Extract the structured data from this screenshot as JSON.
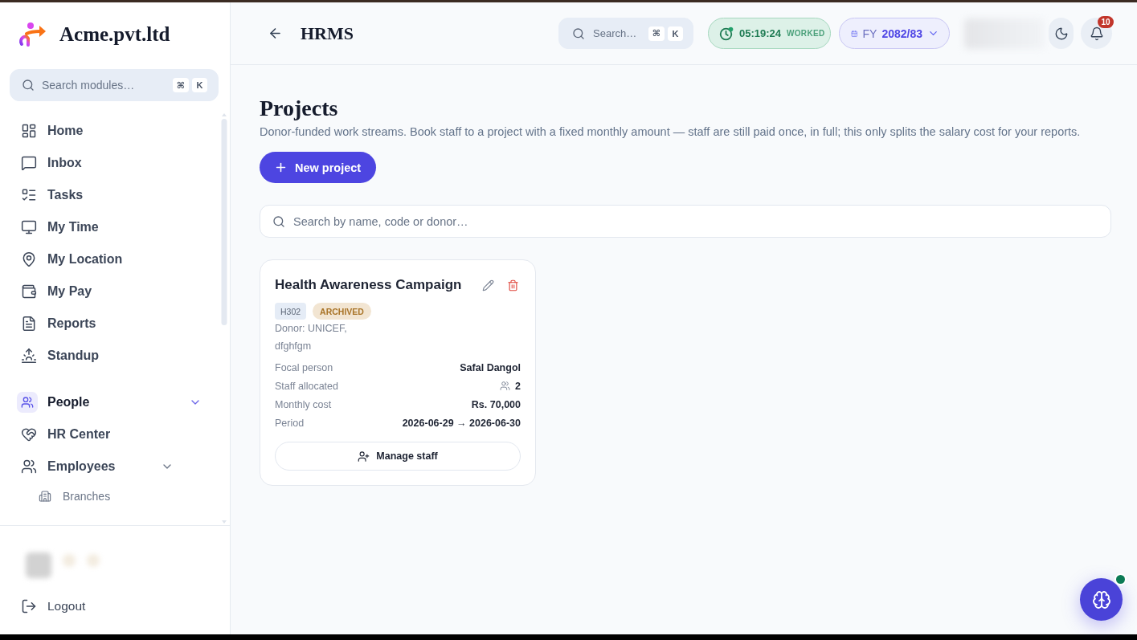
{
  "sidebar": {
    "brand": "Acme.pvt.ltd",
    "search": {
      "placeholder": "Search modules…",
      "shortcut": [
        "⌘",
        "K"
      ]
    },
    "items": [
      {
        "label": "Home"
      },
      {
        "label": "Inbox"
      },
      {
        "label": "Tasks"
      },
      {
        "label": "My Time"
      },
      {
        "label": "My Location"
      },
      {
        "label": "My Pay"
      },
      {
        "label": "Reports"
      },
      {
        "label": "Standup"
      }
    ],
    "sections": [
      {
        "label": "People",
        "expanded": true,
        "items": [
          {
            "label": "HR Center"
          },
          {
            "label": "Employees",
            "expanded": true,
            "children": [
              {
                "label": "Branches"
              }
            ]
          }
        ]
      }
    ],
    "footer": {
      "logout": "Logout"
    }
  },
  "header": {
    "title": "HRMS",
    "search": {
      "placeholder": "Search…",
      "shortcut": [
        "⌘",
        "K"
      ]
    },
    "timer": {
      "time": "05:19:24",
      "label": "WORKED"
    },
    "fiscal_year": {
      "prefix": "FY",
      "value": "2082/83"
    },
    "notifications": {
      "count": "10"
    }
  },
  "page": {
    "title": "Projects",
    "description": "Donor-funded work streams. Book staff to a project with a fixed monthly amount — staff are still paid once, in full; this only splits the salary cost for your reports.",
    "new_button": "New project",
    "search": {
      "placeholder": "Search by name, code or donor…"
    },
    "projects": [
      {
        "name": "Health Awareness Campaign",
        "code": "H302",
        "status": "ARCHIVED",
        "donor": "Donor: UNICEF,",
        "description": "dfghfgm",
        "fields": [
          {
            "kind": "text",
            "label": "Focal person",
            "value": "Safal Dangol"
          },
          {
            "kind": "count",
            "label": "Staff allocated",
            "value": "2"
          },
          {
            "kind": "text",
            "label": "Monthly cost",
            "value": "Rs. 70,000"
          },
          {
            "kind": "text",
            "label": "Period",
            "value": "2026-06-29 → 2026-06-30"
          }
        ],
        "action": "Manage staff"
      }
    ]
  }
}
